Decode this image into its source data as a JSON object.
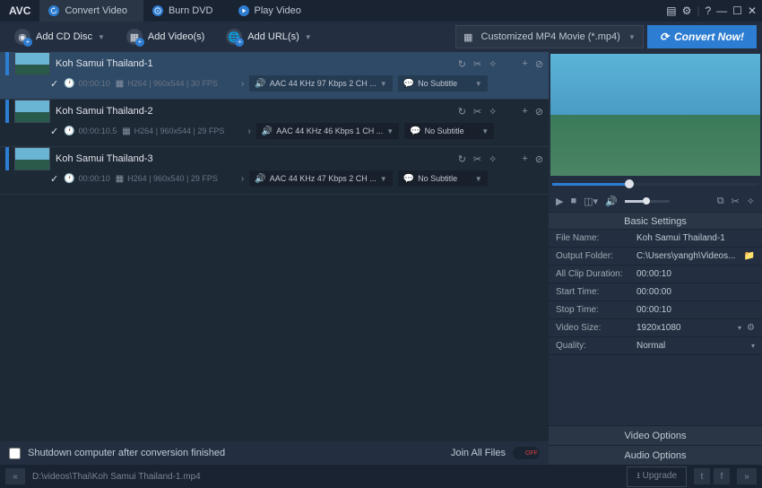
{
  "app": {
    "logo": "AVC"
  },
  "tabs": [
    {
      "label": "Convert Video",
      "active": true
    },
    {
      "label": "Burn DVD",
      "active": false
    },
    {
      "label": "Play Video",
      "active": false
    }
  ],
  "toolbar": {
    "add_cd": "Add CD Disc",
    "add_videos": "Add Video(s)",
    "add_urls": "Add URL(s)",
    "output": "Customized MP4 Movie (*.mp4)",
    "convert": "Convert Now!"
  },
  "items": [
    {
      "title": "Koh Samui Thailand-1",
      "duration": "00:00:10",
      "codec": "H264",
      "res": "960x544",
      "fps": "30 FPS",
      "audio": "AAC 44 KHz 97 Kbps 2 CH ...",
      "subtitle": "No Subtitle",
      "selected": true
    },
    {
      "title": "Koh Samui Thailand-2",
      "duration": "00:00:10.5",
      "codec": "H264",
      "res": "960x544",
      "fps": "29 FPS",
      "audio": "AAC 44 KHz 46 Kbps 1 CH ...",
      "subtitle": "No Subtitle",
      "selected": false
    },
    {
      "title": "Koh Samui Thailand-3",
      "duration": "00:00:10",
      "codec": "H264",
      "res": "960x540",
      "fps": "29 FPS",
      "audio": "AAC 44 KHz 47 Kbps 2 CH ...",
      "subtitle": "No Subtitle",
      "selected": false
    }
  ],
  "footer": {
    "shutdown": "Shutdown computer after conversion finished",
    "join": "Join All Files",
    "toggle": "OFF"
  },
  "settings": {
    "title": "Basic Settings",
    "rows": {
      "file_name_k": "File Name:",
      "file_name_v": "Koh Samui Thailand-1",
      "output_k": "Output Folder:",
      "output_v": "C:\\Users\\yangh\\Videos...",
      "clip_k": "All Clip Duration:",
      "clip_v": "00:00:10",
      "start_k": "Start Time:",
      "start_v": "00:00:00",
      "stop_k": "Stop Time:",
      "stop_v": "00:00:10",
      "size_k": "Video Size:",
      "size_v": "1920x1080",
      "quality_k": "Quality:",
      "quality_v": "Normal"
    },
    "video_opts": "Video Options",
    "audio_opts": "Audio Options"
  },
  "status": {
    "path": "D:\\videos\\Thai\\Koh Samui Thailand-1.mp4",
    "upgrade": "Upgrade"
  }
}
